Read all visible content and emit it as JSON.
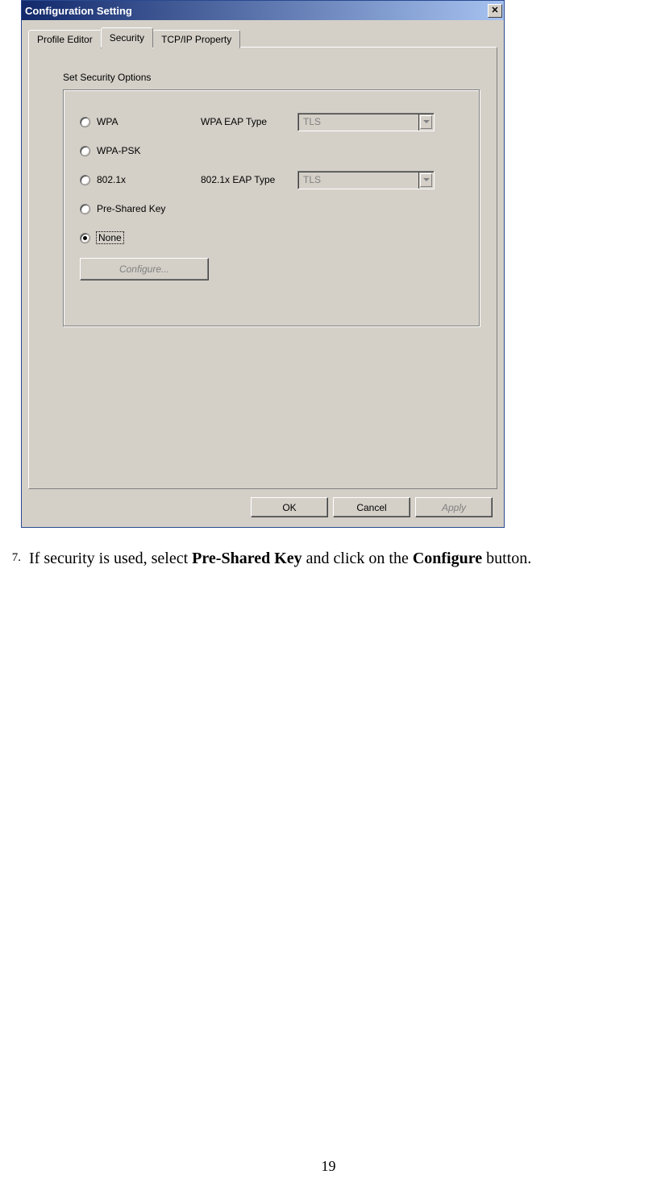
{
  "dialog": {
    "title": "Configuration Setting",
    "close_glyph": "✕",
    "tabs": {
      "profile": "Profile Editor",
      "security": "Security",
      "tcpip": "TCP/IP Property"
    },
    "group_label": "Set Security Options",
    "options": {
      "wpa": "WPA",
      "wpa_psk": "WPA-PSK",
      "dot1x": "802.1x",
      "psk": "Pre-Shared Key",
      "none": "None"
    },
    "selected": "none",
    "eap": {
      "wpa_label": "WPA EAP Type",
      "wpa_value": "TLS",
      "dot1x_label": "802.1x EAP Type",
      "dot1x_value": "TLS"
    },
    "configure_label": "Configure...",
    "buttons": {
      "ok": "OK",
      "cancel": "Cancel",
      "apply": "Apply"
    }
  },
  "step": {
    "number": "7.",
    "t1": "If security is used, select ",
    "b1": "Pre-Shared Key",
    "t2": " and click on the ",
    "b2": "Configure",
    "t3": " button."
  },
  "page_number": "19"
}
